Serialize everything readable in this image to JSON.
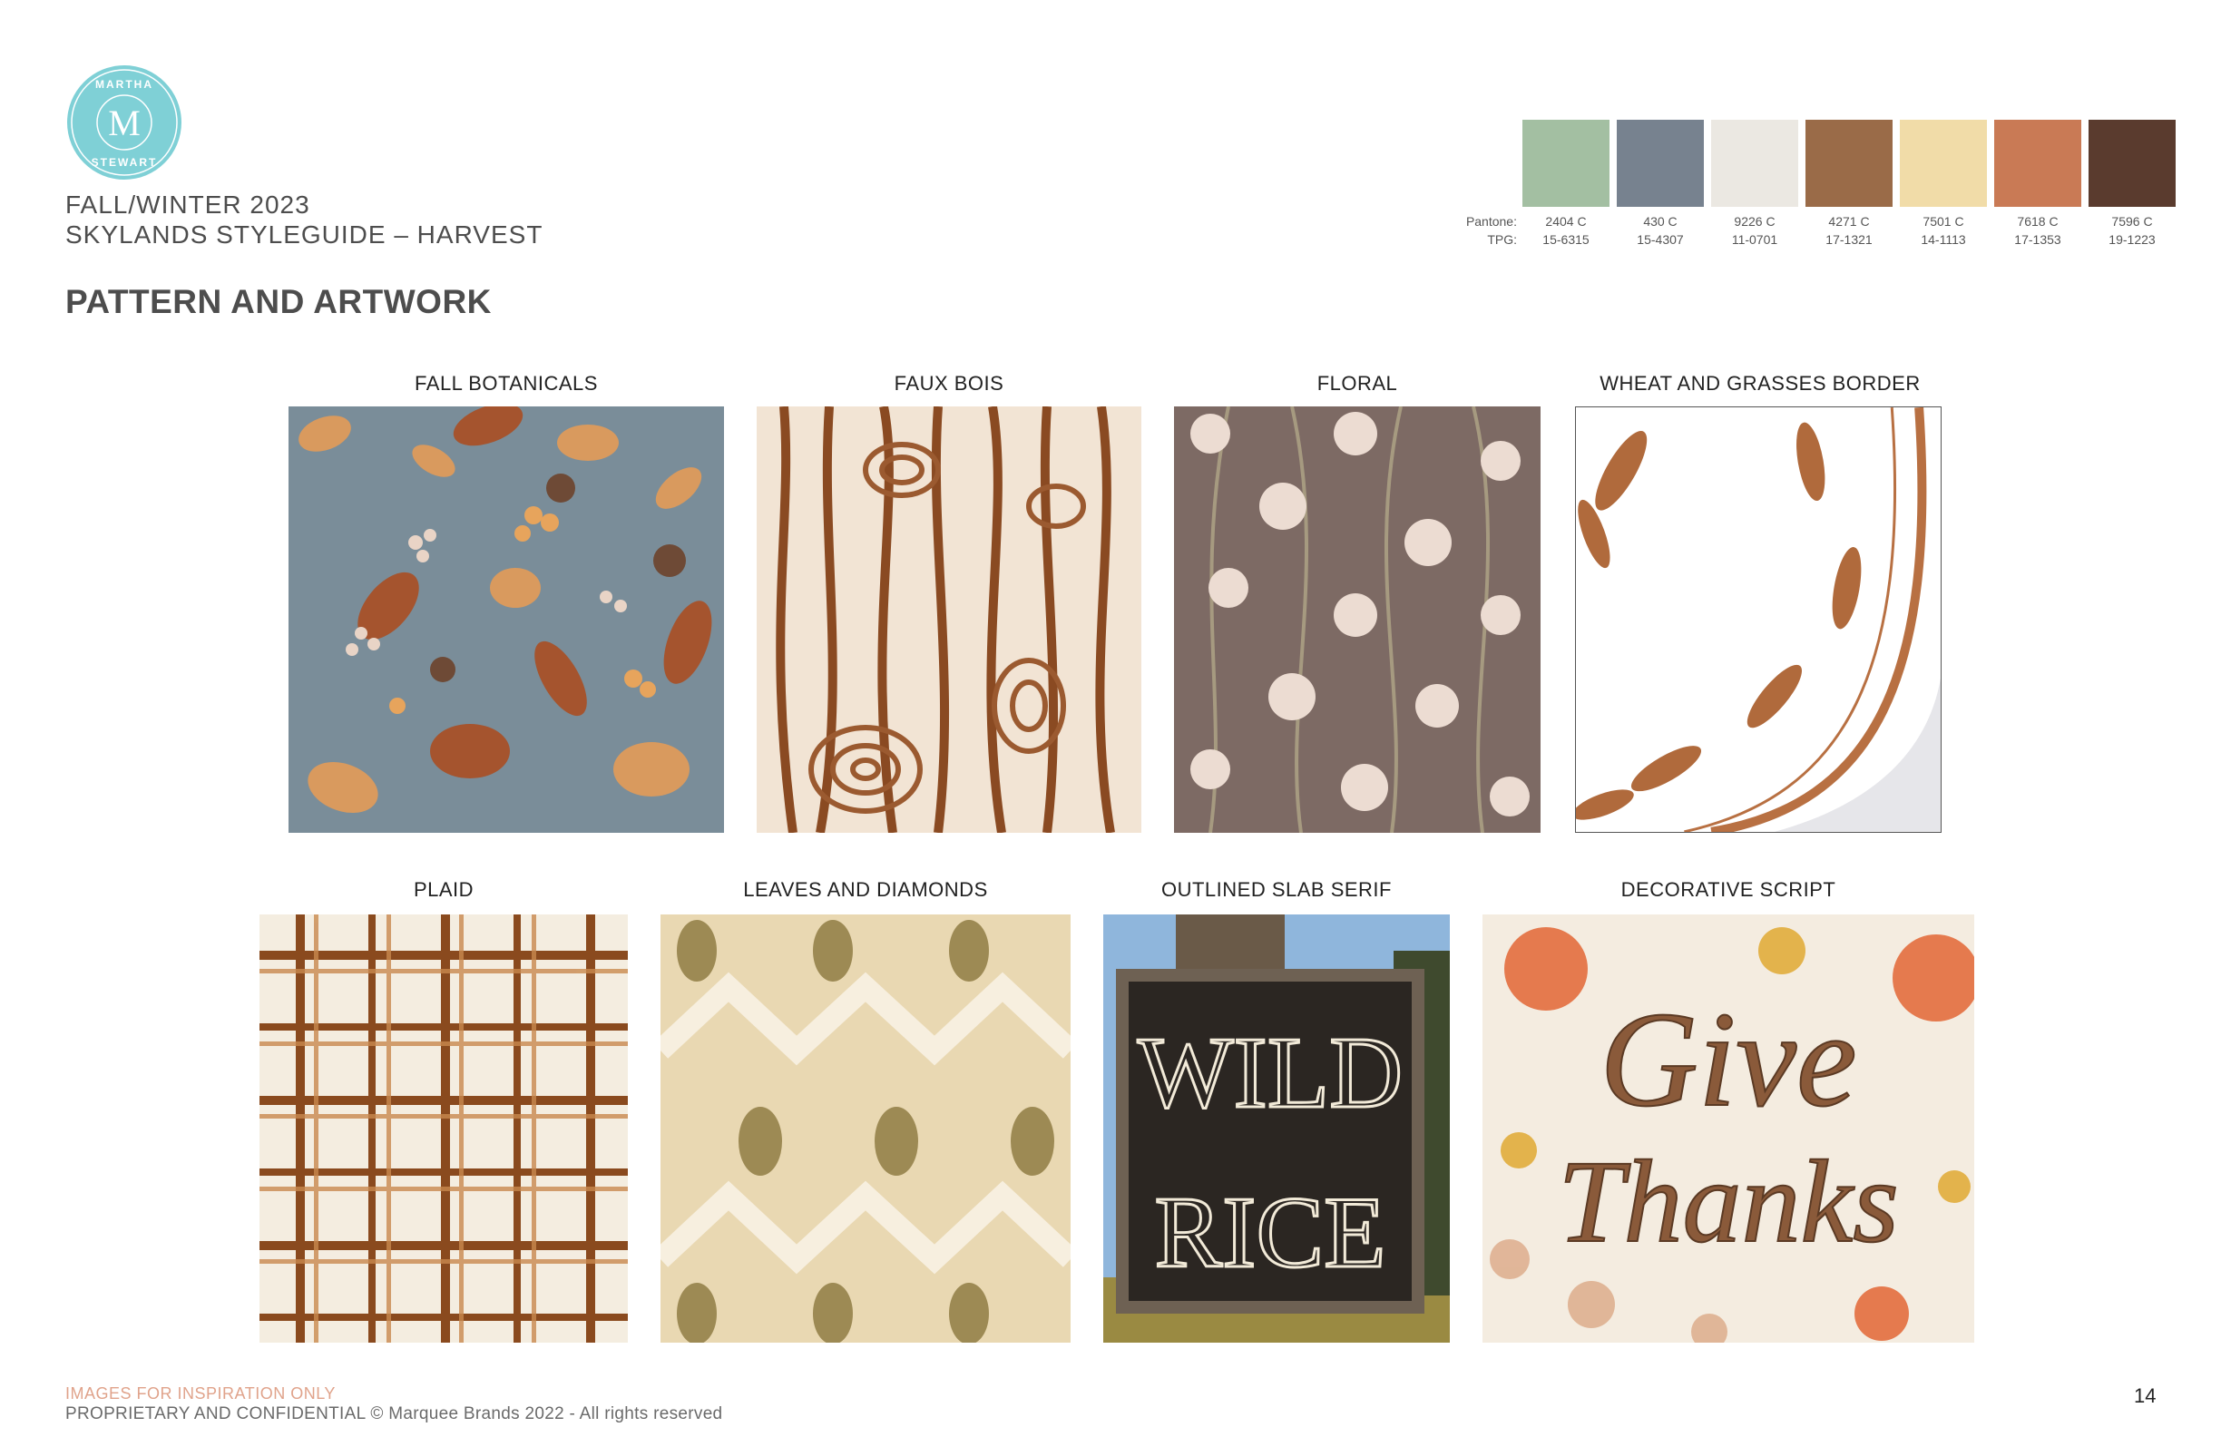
{
  "header": {
    "brand_logo_text_top": "MARTHA",
    "brand_logo_monogram": "M",
    "brand_logo_text_bottom": "STEWART",
    "season": "FALL/WINTER 2023",
    "guide": "SKYLANDS STYLEGUIDE – HARVEST",
    "section_title": "PATTERN AND ARTWORK"
  },
  "palette": {
    "pantone_label": "Pantone:",
    "tpg_label": "TPG:",
    "swatches": [
      {
        "hex": "#a3bfa2",
        "pantone": "2404 C",
        "tpg": "15-6315"
      },
      {
        "hex": "#77828f",
        "pantone": "430 C",
        "tpg": "15-4307"
      },
      {
        "hex": "#ebe8e2",
        "pantone": "9226 C",
        "tpg": "11-0701"
      },
      {
        "hex": "#9a6b48",
        "pantone": "4271 C",
        "tpg": "17-1321"
      },
      {
        "hex": "#f1dca8",
        "pantone": "7501 C",
        "tpg": "14-1113"
      },
      {
        "hex": "#c97a55",
        "pantone": "7618 C",
        "tpg": "17-1353"
      },
      {
        "hex": "#5a3b2e",
        "pantone": "7596 C",
        "tpg": "19-1223"
      }
    ]
  },
  "tiles": {
    "fall_botanicals": "FALL BOTANICALS",
    "faux_bois": "FAUX BOIS",
    "floral": "FLORAL",
    "wheat_border": "WHEAT AND GRASSES BORDER",
    "plaid": "PLAID",
    "leaves_diamonds": "LEAVES AND DIAMONDS",
    "slab_serif": "OUTLINED SLAB SERIF",
    "script": "DECORATIVE SCRIPT",
    "sign_line1": "WILD",
    "sign_line2": "RICE",
    "script_line1": "Give",
    "script_line2": "Thanks"
  },
  "footer": {
    "note": "IMAGES FOR INSPIRATION ONLY",
    "legal": "PROPRIETARY AND CONFIDENTIAL © Marquee Brands 2022 - All rights reserved",
    "page_number": "14"
  }
}
